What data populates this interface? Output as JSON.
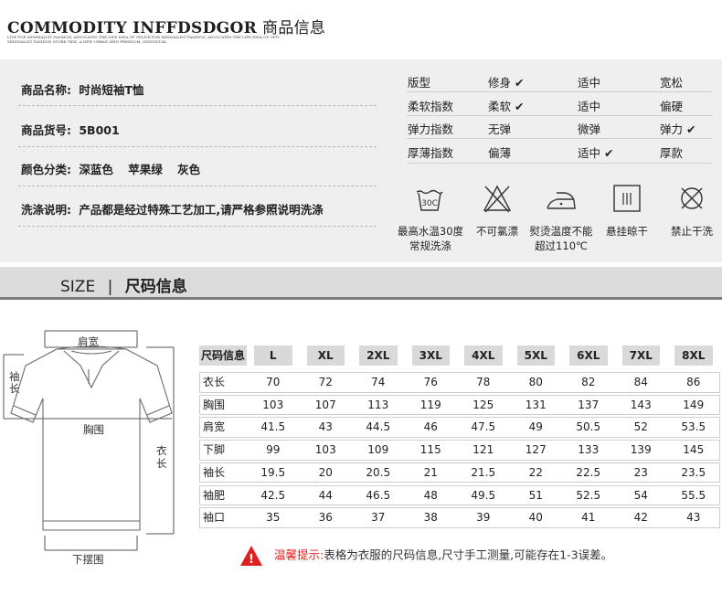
{
  "header": {
    "title_en": "COMMODITY INFFDSDGOR",
    "title_cn": "商品信息",
    "subtitle_lines": [
      "LIVE FOR MINIMALIST FASHION, ADVOCATES THE LIFE IDEA OF OPLIVE FOR MINIMALIST FASHION, ADVOCATES THE LIFE IDEA OF OPTI",
      "MINIMALIST FASHION STORE TIDE, A NEW URBAN MEN FREEDOM, INDIVIDUAL"
    ]
  },
  "product": {
    "name_label": "商品名称:",
    "name_value": "时尚短袖T恤",
    "sku_label": "商品货号:",
    "sku_value": "5B001",
    "color_label": "颜色分类:",
    "colors": [
      "深蓝色",
      "苹果绿",
      "灰色"
    ],
    "wash_label": "洗涤说明:",
    "wash_value": "产品都是经过特殊工艺加工,请严格参照说明洗涤"
  },
  "attributes": [
    {
      "name": "版型",
      "options": [
        "修身",
        "适中",
        "宽松"
      ],
      "checked": 0
    },
    {
      "name": "柔软指数",
      "options": [
        "柔软",
        "适中",
        "偏硬"
      ],
      "checked": 0
    },
    {
      "name": "弹力指数",
      "options": [
        "无弹",
        "微弹",
        "弹力"
      ],
      "checked": 2
    },
    {
      "name": "厚薄指数",
      "options": [
        "偏薄",
        "适中",
        "厚款"
      ],
      "checked": 1
    }
  ],
  "check_mark": "✔",
  "care": [
    {
      "icon": "wash-30c-icon",
      "icon_text": "30C",
      "lines": [
        "最高水温30度",
        "常规洗涤"
      ]
    },
    {
      "icon": "no-bleach-icon",
      "lines": [
        "不可氯漂"
      ]
    },
    {
      "icon": "iron-110c-icon",
      "lines": [
        "熨烫温度不能",
        "超过110℃"
      ]
    },
    {
      "icon": "hang-dry-icon",
      "lines": [
        "悬挂晾干"
      ]
    },
    {
      "icon": "no-dry-clean-icon",
      "lines": [
        "禁止干洗"
      ]
    }
  ],
  "size_section": {
    "en": "SIZE",
    "sep": "|",
    "cn": "尺码信息"
  },
  "diagram": {
    "shoulder": "肩宽",
    "sleeve": "袖长",
    "chest": "胸围",
    "length": "衣长",
    "hem": "下摆围"
  },
  "size_table": {
    "header_label": "尺码信息",
    "sizes": [
      "L",
      "XL",
      "2XL",
      "3XL",
      "4XL",
      "5XL",
      "6XL",
      "7XL",
      "8XL"
    ],
    "rows": [
      {
        "label": "衣长",
        "values": [
          "70",
          "72",
          "74",
          "76",
          "78",
          "80",
          "82",
          "84",
          "86"
        ]
      },
      {
        "label": "胸围",
        "values": [
          "103",
          "107",
          "113",
          "119",
          "125",
          "131",
          "137",
          "143",
          "149"
        ]
      },
      {
        "label": "肩宽",
        "values": [
          "41.5",
          "43",
          "44.5",
          "46",
          "47.5",
          "49",
          "50.5",
          "52",
          "53.5"
        ]
      },
      {
        "label": "下脚",
        "values": [
          "99",
          "103",
          "109",
          "115",
          "121",
          "127",
          "133",
          "139",
          "145"
        ]
      },
      {
        "label": "袖长",
        "values": [
          "19.5",
          "20",
          "20.5",
          "21",
          "21.5",
          "22",
          "22.5",
          "23",
          "23.5"
        ]
      },
      {
        "label": "袖肥",
        "values": [
          "42.5",
          "44",
          "46.5",
          "48",
          "49.5",
          "51",
          "52.5",
          "54",
          "55.5"
        ]
      },
      {
        "label": "袖口",
        "values": [
          "35",
          "36",
          "37",
          "38",
          "39",
          "40",
          "41",
          "42",
          "43"
        ]
      }
    ]
  },
  "notice": {
    "label": "温馨提示:",
    "text": "表格为衣服的尺码信息,尺寸手工测量,可能存在1-3误差。",
    "warn_mark": "!"
  },
  "colors": {
    "band": "#dcdcdc",
    "band_border": "#7b7b7b",
    "panel": "#efefef",
    "warn": "#e02020"
  }
}
